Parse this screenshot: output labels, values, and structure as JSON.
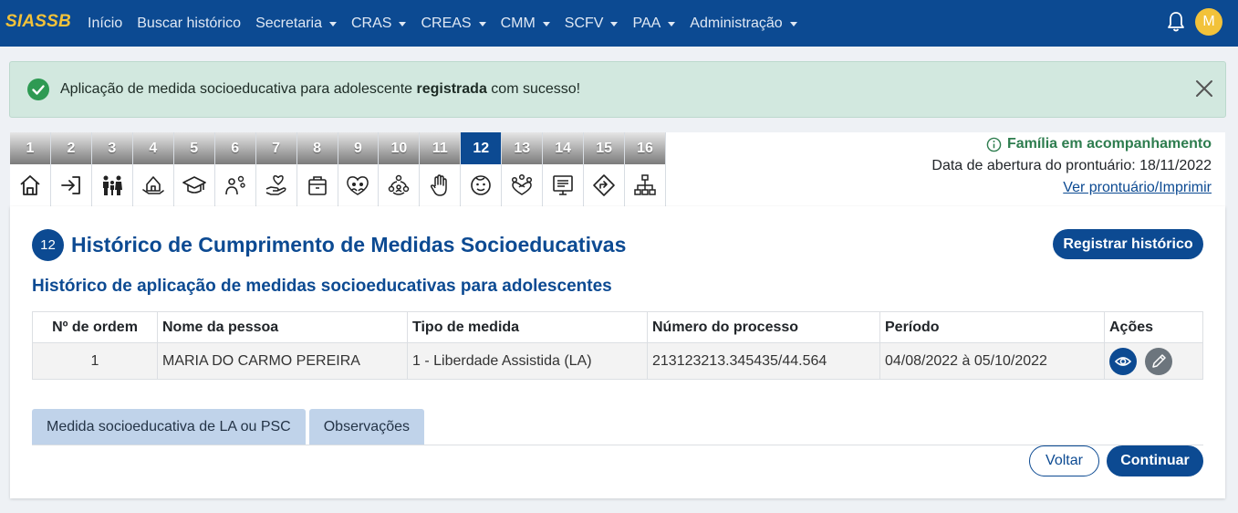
{
  "navbar": {
    "brand": "SIASSB",
    "items": [
      {
        "label": "Início",
        "dropdown": false
      },
      {
        "label": "Buscar histórico",
        "dropdown": false
      },
      {
        "label": "Secretaria",
        "dropdown": true
      },
      {
        "label": "CRAS",
        "dropdown": true
      },
      {
        "label": "CREAS",
        "dropdown": true
      },
      {
        "label": "CMM",
        "dropdown": true
      },
      {
        "label": "SCFV",
        "dropdown": true
      },
      {
        "label": "PAA",
        "dropdown": true
      },
      {
        "label": "Administração",
        "dropdown": true
      }
    ],
    "avatar_initial": "M"
  },
  "alert": {
    "text_before": "Aplicação de medida socioeducativa para adolescente ",
    "text_bold": "registrada",
    "text_after": " com sucesso!"
  },
  "steps": [
    {
      "num": "1",
      "icon": "home-icon"
    },
    {
      "num": "2",
      "icon": "sign-in-icon"
    },
    {
      "num": "3",
      "icon": "family-icon"
    },
    {
      "num": "4",
      "icon": "housing-icon"
    },
    {
      "num": "5",
      "icon": "graduation-cap-icon"
    },
    {
      "num": "6",
      "icon": "care-icon"
    },
    {
      "num": "7",
      "icon": "heart-hand-icon"
    },
    {
      "num": "8",
      "icon": "medical-kit-icon"
    },
    {
      "num": "9",
      "icon": "group-heart-icon"
    },
    {
      "num": "10",
      "icon": "network-people-icon"
    },
    {
      "num": "11",
      "icon": "stop-hand-icon"
    },
    {
      "num": "12",
      "icon": "child-face-icon"
    },
    {
      "num": "13",
      "icon": "community-icon"
    },
    {
      "num": "14",
      "icon": "document-board-icon"
    },
    {
      "num": "15",
      "icon": "direction-sign-icon"
    },
    {
      "num": "16",
      "icon": "hierarchy-icon"
    }
  ],
  "active_step": "12",
  "status": {
    "family_status": "Família em acompanhamento",
    "opening_date": "Data de abertura do prontuário: 18/11/2022",
    "print_link": "Ver prontuário/Imprimir"
  },
  "page": {
    "badge": "12",
    "title": "Histórico de Cumprimento de Medidas Socioeducativas",
    "register_button": "Registrar histórico",
    "subtitle": "Histórico de aplicação de medidas socioeducativas para adolescentes"
  },
  "table": {
    "headers": [
      "Nº de ordem",
      "Nome da pessoa",
      "Tipo de medida",
      "Número do processo",
      "Período",
      "Ações"
    ],
    "rows": [
      [
        "1",
        "MARIA DO CARMO PEREIRA",
        "1 - Liberdade Assistida (LA)",
        "213123213.345435/44.564",
        "04/08/2022 à 05/10/2022"
      ]
    ]
  },
  "tabs": [
    "Medida socioeducativa de LA ou PSC",
    "Observações"
  ],
  "footer": {
    "back_button": "Voltar",
    "continue_button": "Continuar"
  },
  "colors": {
    "primary": "#0c4a92",
    "brand_yellow": "#f2c23a",
    "success": "#2e7d4f",
    "alert_bg": "#d2e8df",
    "tab_bg": "#c0d3ea"
  }
}
